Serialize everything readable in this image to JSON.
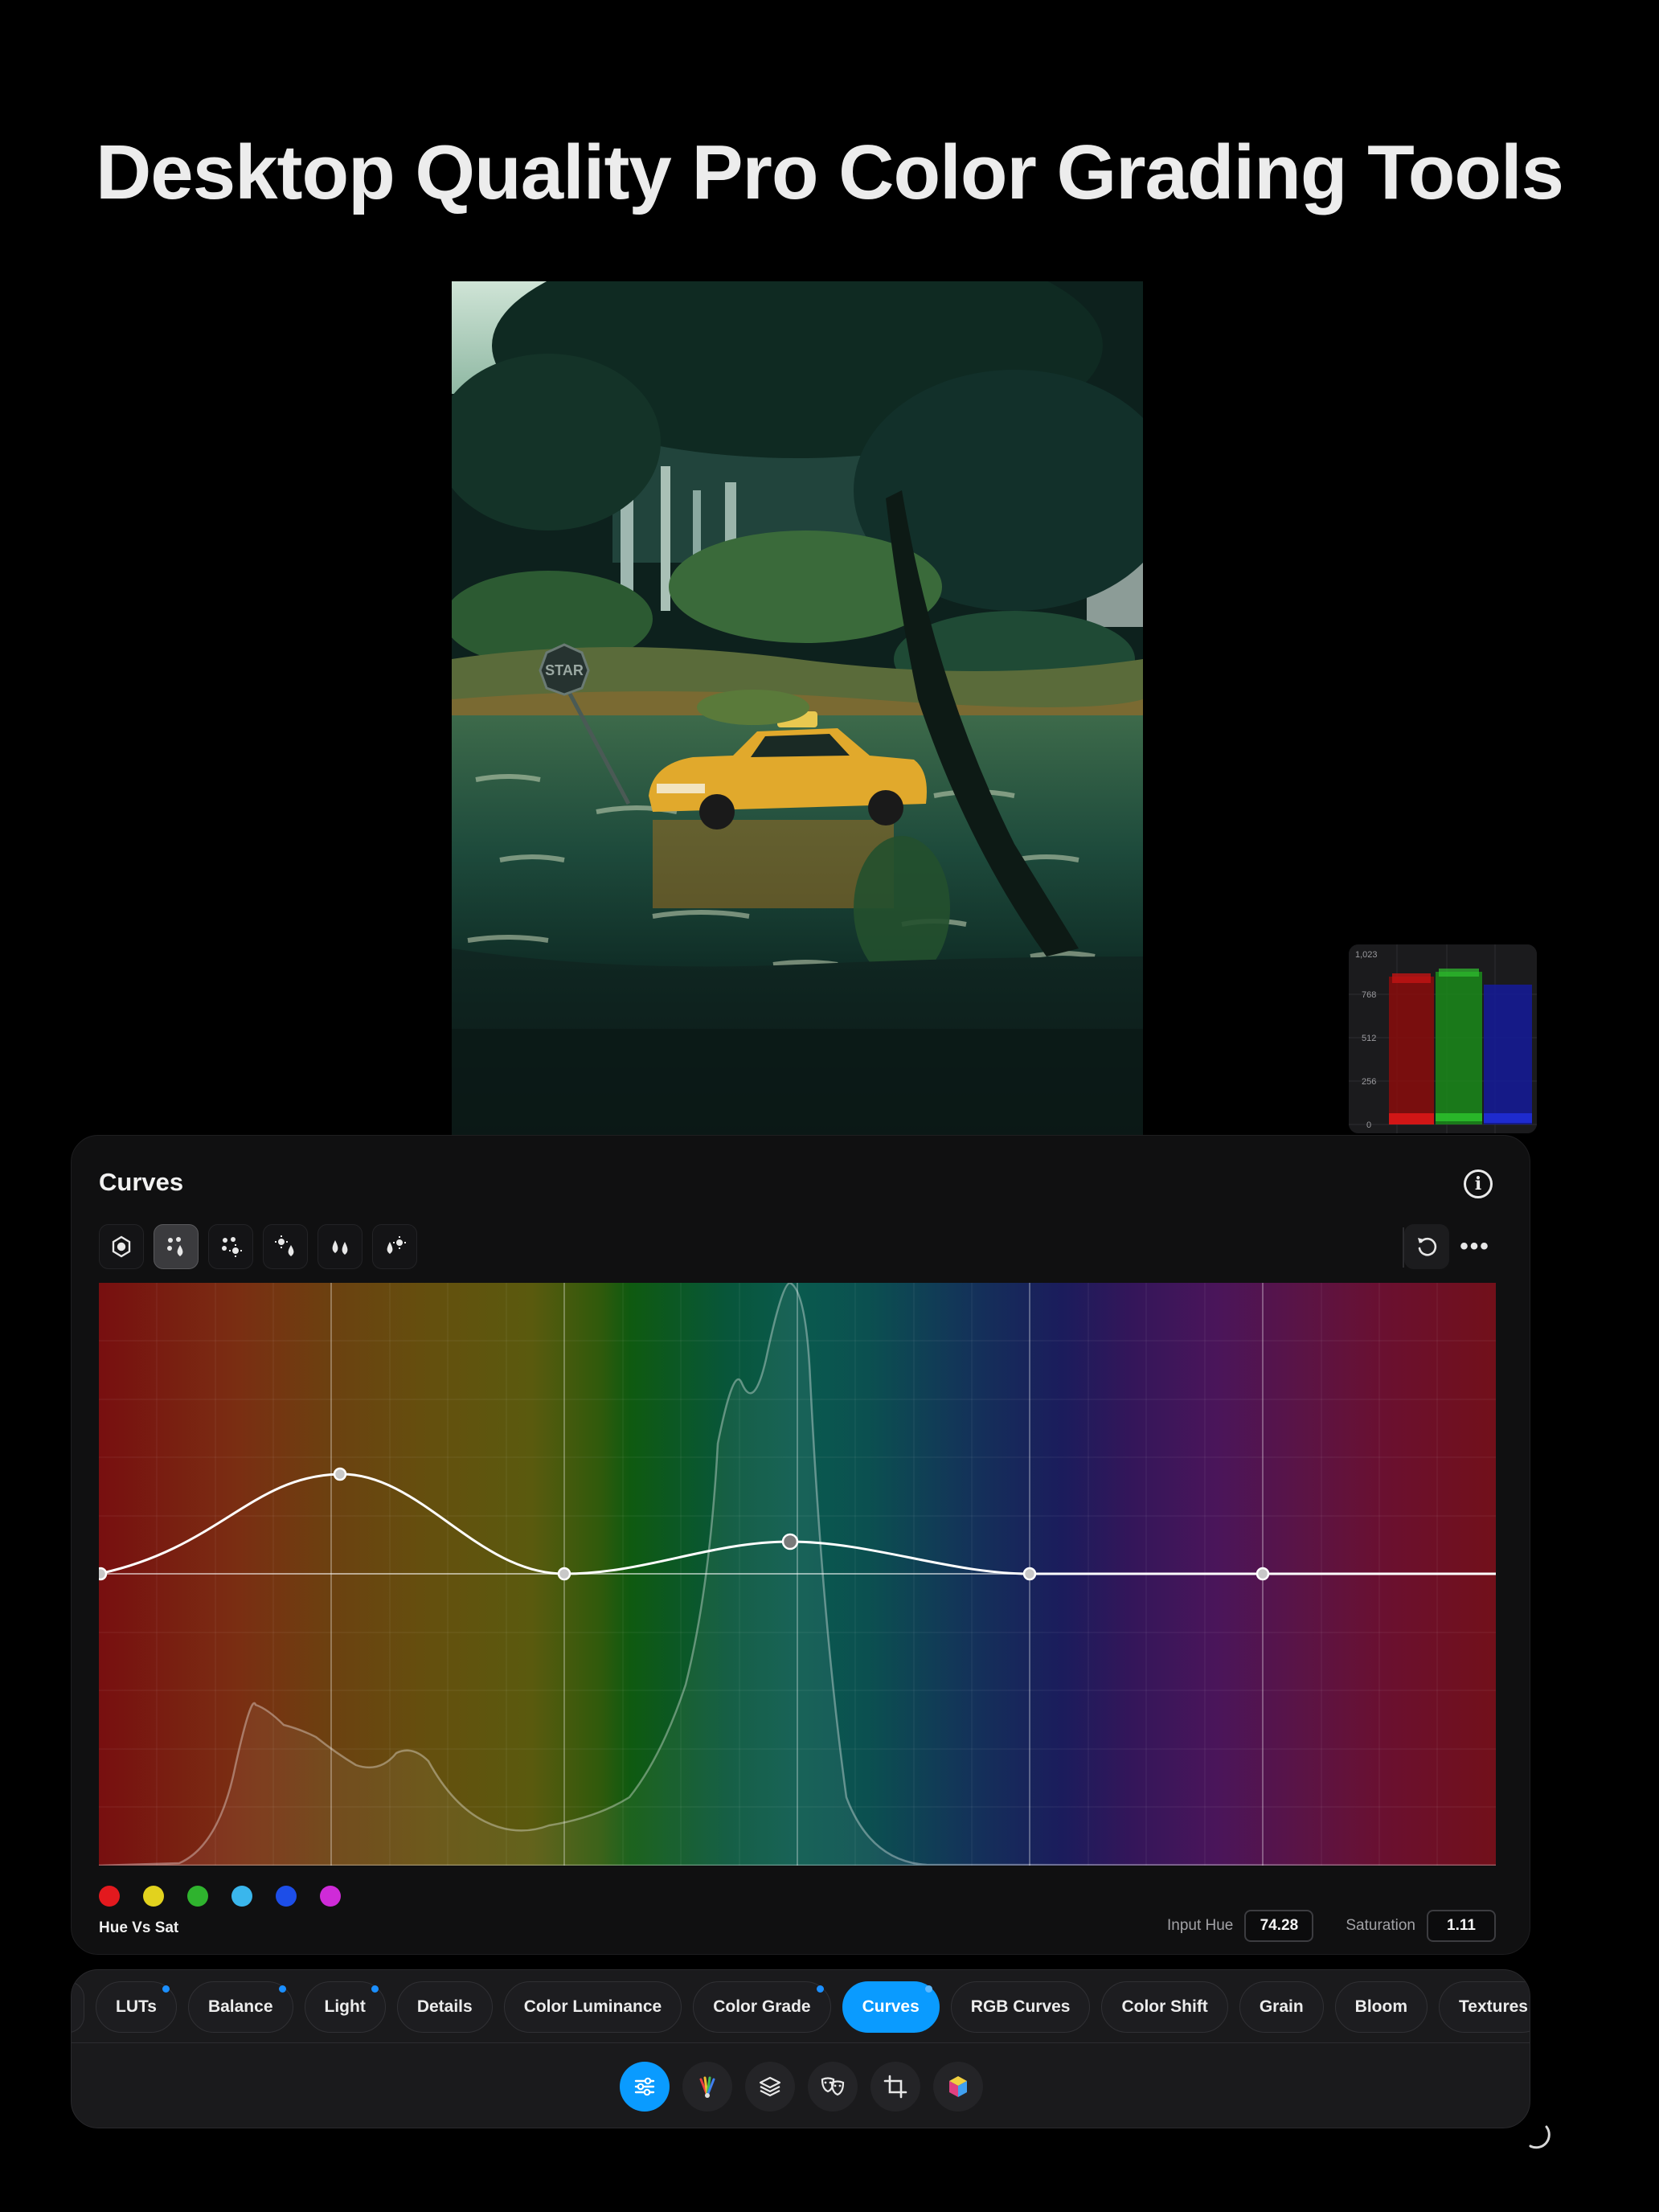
{
  "headline": "Desktop Quality Pro Color Grading Tools",
  "photo": {
    "sign_text": "STAR"
  },
  "scope": {
    "ticks": [
      "1,023",
      "768",
      "512",
      "256",
      "0"
    ]
  },
  "panel": {
    "title": "Curves",
    "info_icon": "info-icon",
    "mode_buttons": [
      "rgb-wheel-icon",
      "hue-vs-sat-icon",
      "hue-vs-lum-icon",
      "lum-vs-sat-icon",
      "sat-vs-sat-icon",
      "sat-vs-lum-icon"
    ],
    "active_mode_index": 1,
    "reset_icon": "reset-icon",
    "more_icon": "more-icon",
    "more_label": "•••",
    "curve_mode": "Hue Vs Sat",
    "input_hue_label": "Input Hue",
    "input_hue_value": "74.28",
    "saturation_label": "Saturation",
    "saturation_value": "1.11",
    "swatch_colors": [
      "#e3191e",
      "#e2d21e",
      "#2fb32e",
      "#3ab6ec",
      "#1d4ee8",
      "#cf2bd8"
    ]
  },
  "tabs": [
    {
      "label": "",
      "dot": false
    },
    {
      "label": "LUTs",
      "dot": true
    },
    {
      "label": "Balance",
      "dot": true
    },
    {
      "label": "Light",
      "dot": true
    },
    {
      "label": "Details",
      "dot": false
    },
    {
      "label": "Color Luminance",
      "dot": false
    },
    {
      "label": "Color Grade",
      "dot": true
    },
    {
      "label": "Curves",
      "dot": true,
      "active": true
    },
    {
      "label": "RGB Curves",
      "dot": false
    },
    {
      "label": "Color Shift",
      "dot": false
    },
    {
      "label": "Grain",
      "dot": false
    },
    {
      "label": "Bloom",
      "dot": false
    },
    {
      "label": "Textures",
      "dot": false
    }
  ],
  "tools": [
    {
      "icon": "adjust-sliders-icon",
      "active": true
    },
    {
      "icon": "color-fan-icon",
      "active": false
    },
    {
      "icon": "layers-icon",
      "active": false
    },
    {
      "icon": "masks-icon",
      "active": false
    },
    {
      "icon": "crop-icon",
      "active": false
    },
    {
      "icon": "lut-cube-icon",
      "active": false
    }
  ],
  "accent_color": "#0a9bff"
}
